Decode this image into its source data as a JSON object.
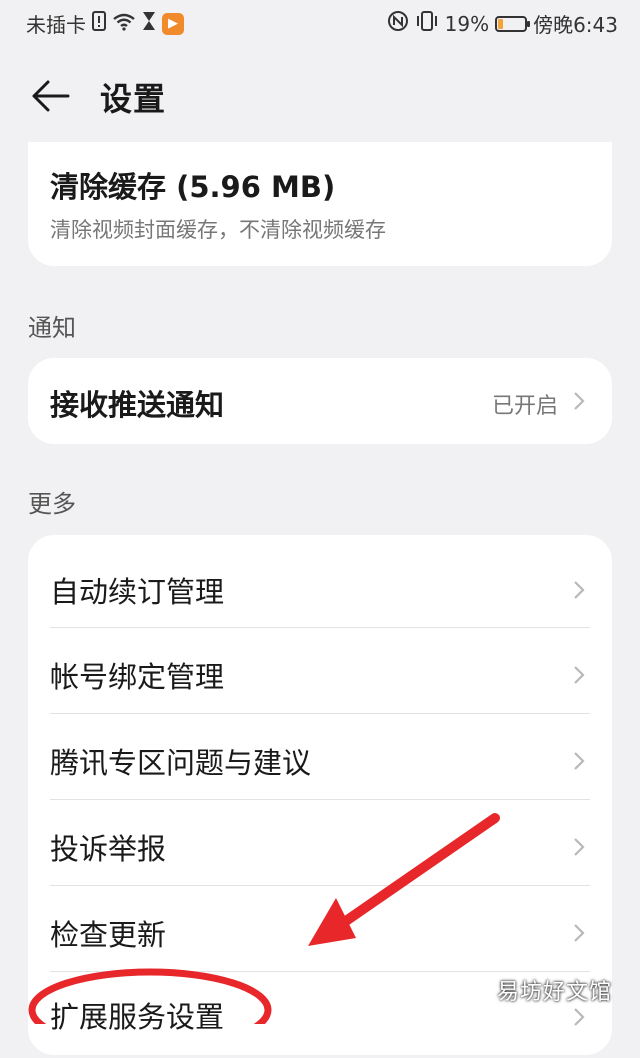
{
  "status_bar": {
    "carrier": "未插卡",
    "battery_percent": "19%",
    "battery_level": 0.19,
    "time": "傍晚6:43",
    "icons": [
      "sim-alert-icon",
      "wifi-icon",
      "hourglass-icon",
      "app-notification-icon",
      "nfc-icon",
      "vibrate-icon",
      "battery-icon"
    ]
  },
  "header": {
    "title": "设置",
    "back_icon": "arrow-left-icon"
  },
  "cache": {
    "title": "清除缓存 (5.96 MB)",
    "subtitle": "清除视频封面缓存，不清除视频缓存"
  },
  "notify": {
    "section_label": "通知",
    "item": {
      "label": "接收推送通知",
      "value": "已开启"
    }
  },
  "more": {
    "section_label": "更多",
    "items": [
      {
        "label": "自动续订管理"
      },
      {
        "label": "帐号绑定管理"
      },
      {
        "label": "腾讯专区问题与建议"
      },
      {
        "label": "投诉举报"
      },
      {
        "label": "检查更新"
      },
      {
        "label": "扩展服务设置"
      }
    ]
  },
  "annotation": {
    "arrow_color": "#e8272a",
    "circle_color": "#e8272a"
  },
  "watermark": "易坊好文馆"
}
